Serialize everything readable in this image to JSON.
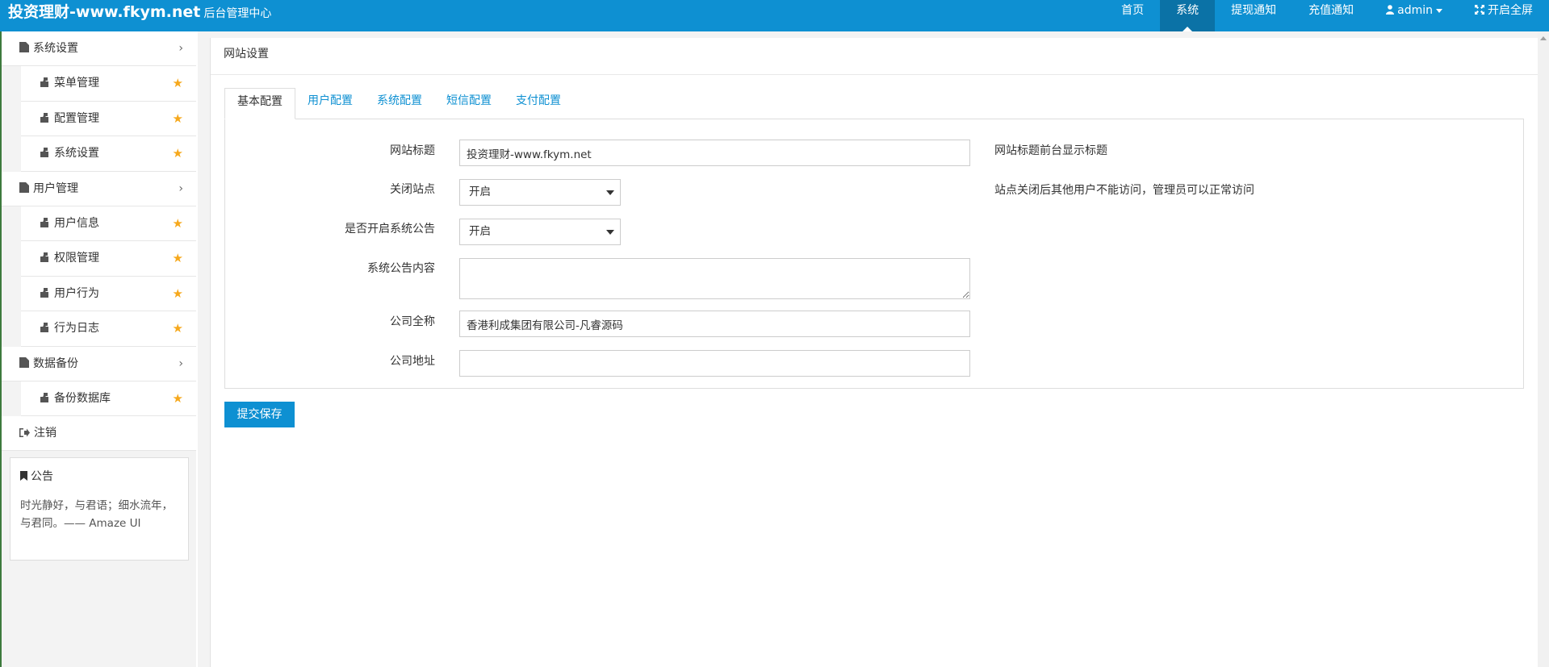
{
  "header": {
    "brand_name": "投资理财-www.fkym.net",
    "brand_sub": "后台管理中心",
    "nav": [
      {
        "label": "首页",
        "active": false
      },
      {
        "label": "系统",
        "active": true
      },
      {
        "label": "提现通知",
        "active": false
      },
      {
        "label": "充值通知",
        "active": false
      }
    ],
    "user_label": "admin",
    "fullscreen_label": "开启全屏"
  },
  "sidebar": {
    "groups": [
      {
        "label": "系统设置",
        "items": [
          "菜单管理",
          "配置管理",
          "系统设置"
        ]
      },
      {
        "label": "用户管理",
        "items": [
          "用户信息",
          "权限管理",
          "用户行为",
          "行为日志"
        ]
      },
      {
        "label": "数据备份",
        "items": [
          "备份数据库"
        ]
      }
    ],
    "logout_label": "注销",
    "notice": {
      "title": "公告",
      "text": "时光静好，与君语；细水流年，与君同。—— Amaze UI"
    }
  },
  "main": {
    "page_title": "网站设置",
    "tabs": [
      {
        "label": "基本配置",
        "active": true
      },
      {
        "label": "用户配置",
        "active": false
      },
      {
        "label": "系统配置",
        "active": false
      },
      {
        "label": "短信配置",
        "active": false
      },
      {
        "label": "支付配置",
        "active": false
      }
    ],
    "form": {
      "site_title": {
        "label": "网站标题",
        "value": "投资理财-www.fkym.net",
        "help": "网站标题前台显示标题"
      },
      "close_site": {
        "label": "关闭站点",
        "value": "开启",
        "help": "站点关闭后其他用户不能访问，管理员可以正常访问"
      },
      "enable_notice": {
        "label": "是否开启系统公告",
        "value": "开启"
      },
      "notice_content": {
        "label": "系统公告内容",
        "value": ""
      },
      "company_name": {
        "label": "公司全称",
        "value": "香港利成集团有限公司-凡睿源码"
      },
      "company_address": {
        "label": "公司地址",
        "value": ""
      }
    },
    "submit_label": "提交保存"
  },
  "colors": {
    "primary": "#0e90d2",
    "primary_dark": "#0b72a6",
    "star": "#f6a81c",
    "sidebar_bg": "#f3f3f3"
  }
}
